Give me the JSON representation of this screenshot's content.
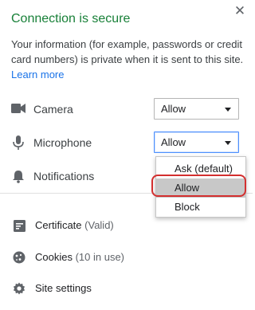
{
  "header": {
    "title": "Connection is secure",
    "close_icon": "close-icon",
    "title_color": "#188038"
  },
  "description": "Your information (for example, passwords or credit card numbers) is private when it is sent to this site.",
  "learn_more": "Learn more",
  "permissions": [
    {
      "icon": "camera-icon",
      "label": "Camera",
      "value": "Allow"
    },
    {
      "icon": "microphone-icon",
      "label": "Microphone",
      "value": "Allow"
    },
    {
      "icon": "bell-icon",
      "label": "Notifications"
    }
  ],
  "dropdown": {
    "options": [
      "Ask (default)",
      "Allow",
      "Block"
    ],
    "selected": "Allow"
  },
  "links": [
    {
      "icon": "certificate-icon",
      "label": "Certificate",
      "sub": "(Valid)"
    },
    {
      "icon": "cookie-icon",
      "label": "Cookies",
      "sub": "(10 in use)"
    },
    {
      "icon": "gear-icon",
      "label": "Site settings",
      "sub": ""
    }
  ],
  "colors": {
    "accent": "#1a73e8",
    "secure": "#188038",
    "highlight": "#d32f2f"
  }
}
